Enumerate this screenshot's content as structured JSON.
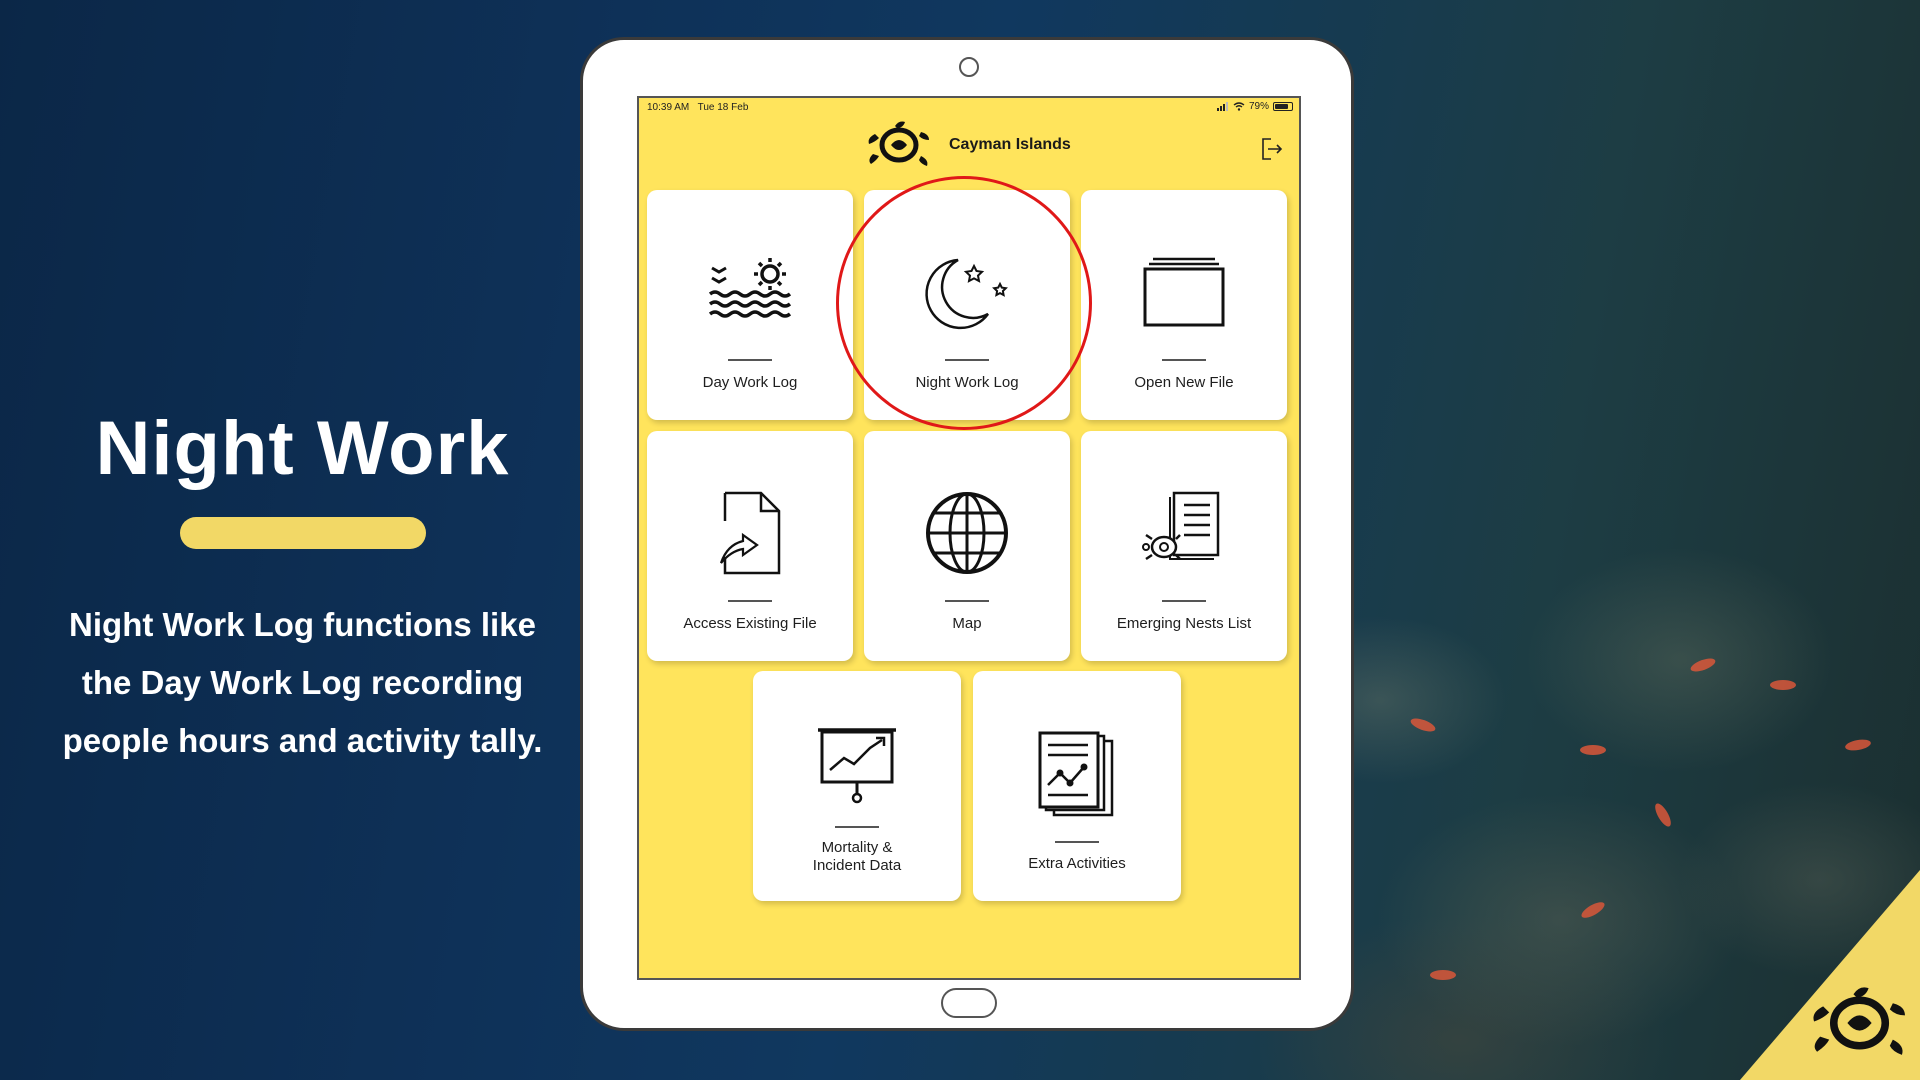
{
  "slide": {
    "title": "Night Work",
    "description": "Night Work Log functions like the Day Work Log recording people hours and activity tally."
  },
  "status_bar": {
    "time": "10:39 AM",
    "date": "Tue 18 Feb",
    "battery": "79%",
    "battery_level": 0.79
  },
  "app": {
    "title": "Cayman Islands",
    "logo_icon": "turtle-logo-icon",
    "logout_icon": "logout-icon"
  },
  "tiles": [
    {
      "label": "Day Work Log",
      "icon": "sun-waves-icon"
    },
    {
      "label": "Night Work Log",
      "icon": "moon-stars-icon",
      "highlighted": true
    },
    {
      "label": "Open New File",
      "icon": "folder-stack-icon"
    },
    {
      "label": "Access Existing File",
      "icon": "file-arrow-icon"
    },
    {
      "label": "Map",
      "icon": "globe-icon"
    },
    {
      "label": "Emerging Nests List",
      "icon": "turtle-list-icon"
    },
    {
      "label": "Mortality &\nIncident Data",
      "label_line1": "Mortality &",
      "label_line2": "Incident Data",
      "icon": "presentation-chart-icon"
    },
    {
      "label": "Extra Activities",
      "icon": "document-chart-icon"
    }
  ],
  "colors": {
    "screen_bg": "#ffe45c",
    "accent_yellow": "#f2d866",
    "highlight_red": "#e01818",
    "slide_bg": "#0e3158"
  }
}
